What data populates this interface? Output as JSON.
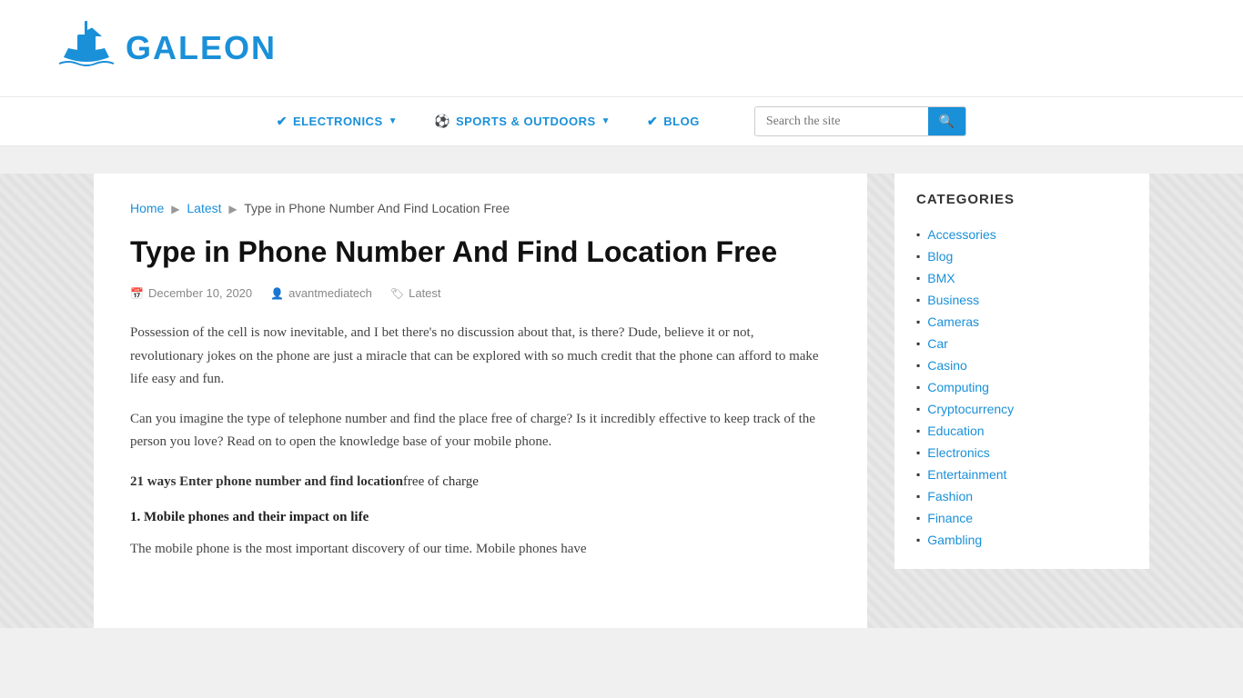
{
  "header": {
    "logo_text": "GALEON"
  },
  "nav": {
    "items": [
      {
        "label": "ELECTRONICS",
        "icon": "✔",
        "has_dropdown": true
      },
      {
        "label": "SPORTS & OUTDOORS",
        "icon": "⚽",
        "has_dropdown": true
      },
      {
        "label": "BLOG",
        "icon": "✔",
        "has_dropdown": false
      }
    ],
    "search_placeholder": "Search the site"
  },
  "breadcrumb": {
    "home": "Home",
    "latest": "Latest",
    "current": "Type in Phone Number And Find Location Free"
  },
  "article": {
    "title": "Type in Phone Number And Find Location Free",
    "date": "December 10, 2020",
    "author": "avantmediatech",
    "tag": "Latest",
    "paragraphs": [
      "Possession of the cell is now inevitable, and I bet there's no discussion about that, is there? Dude, believe it or not, revolutionary jokes on the phone are just a miracle that can be explored with so much credit that the phone can afford to make life easy and fun.",
      "Can you imagine the type of telephone number and find the place free of charge? Is it incredibly effective to keep track of the person you love? Read on to open the knowledge base of your mobile phone."
    ],
    "highlight_bold": "21 ways Enter phone number and find location",
    "highlight_normal": "free of charge",
    "subheading": "1. Mobile phones and their impact on life",
    "last_paragraph": "The mobile phone is the most important discovery of our time. Mobile phones have"
  },
  "sidebar": {
    "categories_title": "CATEGORIES",
    "categories": [
      "Accessories",
      "Blog",
      "BMX",
      "Business",
      "Cameras",
      "Car",
      "Casino",
      "Computing",
      "Cryptocurrency",
      "Education",
      "Electronics",
      "Entertainment",
      "Fashion",
      "Finance",
      "Gambling"
    ]
  }
}
